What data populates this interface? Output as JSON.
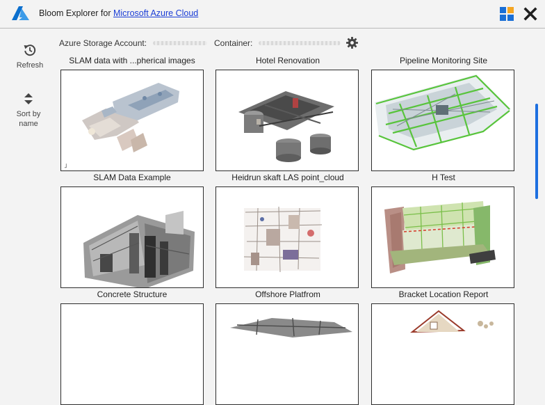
{
  "titlebar": {
    "app_name": "Bloom Explorer for ",
    "link_text": "Microsoft Azure Cloud",
    "icons": {
      "logo": "azure-logo-icon",
      "grid": "windows-grid-icon",
      "close": "close-icon"
    },
    "colors": {
      "azure_blue": "#0b6fce",
      "link": "#1a3dd6",
      "grid_orange": "#f5a623"
    }
  },
  "sidebar": {
    "refresh_label": "Refresh",
    "sort_label": "Sort by name",
    "icons": {
      "refresh": "history-refresh-icon",
      "sort": "sort-arrows-icon"
    }
  },
  "info": {
    "storage_label": "Azure Storage Account:",
    "container_label": "Container:",
    "settings_icon": "gear-icon"
  },
  "projects": [
    {
      "title": "SLAM data with ...pherical images",
      "thumb_mark": "˩"
    },
    {
      "title": "Hotel Renovation"
    },
    {
      "title": "Pipeline Monitoring Site"
    },
    {
      "title": "SLAM Data Example"
    },
    {
      "title": "Heidrun skaft LAS point_cloud"
    },
    {
      "title": "H Test"
    },
    {
      "title": "Concrete Structure"
    },
    {
      "title": "Offshore Platfrom"
    },
    {
      "title": "Bracket Location Report"
    }
  ],
  "scrollbar": {
    "color": "#1d6fe0"
  }
}
